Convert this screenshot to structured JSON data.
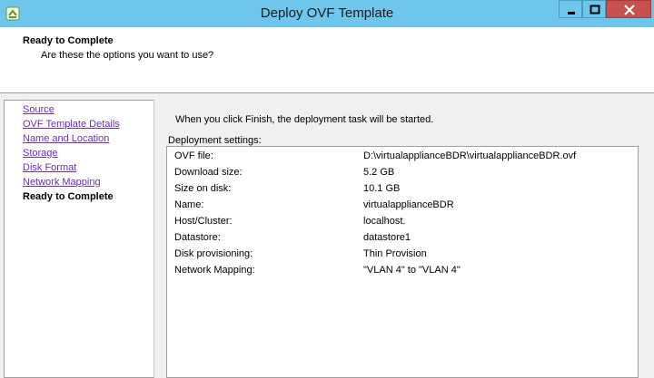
{
  "window": {
    "title": "Deploy OVF Template"
  },
  "header": {
    "title": "Ready to Complete",
    "subtitle": "Are these the options you want to use?"
  },
  "nav": {
    "items": [
      {
        "label": "Source",
        "current": false
      },
      {
        "label": "OVF Template Details",
        "current": false
      },
      {
        "label": "Name and Location",
        "current": false
      },
      {
        "label": "Storage",
        "current": false
      },
      {
        "label": "Disk Format",
        "current": false
      },
      {
        "label": "Network Mapping",
        "current": false
      },
      {
        "label": "Ready to Complete",
        "current": true
      }
    ]
  },
  "main": {
    "intro": "When you click Finish, the deployment task will be started.",
    "settings_label": "Deployment settings:",
    "settings": [
      {
        "name": "OVF file:",
        "value": "D:\\virtualapplianceBDR\\virtualapplianceBDR.ovf"
      },
      {
        "name": "Download size:",
        "value": "5.2 GB"
      },
      {
        "name": "Size on disk:",
        "value": "10.1 GB"
      },
      {
        "name": "Name:",
        "value": "virtualapplianceBDR"
      },
      {
        "name": "Host/Cluster:",
        "value": "localhost."
      },
      {
        "name": "Datastore:",
        "value": "datastore1"
      },
      {
        "name": "Disk provisioning:",
        "value": "Thin Provision"
      },
      {
        "name": "Network Mapping:",
        "value": "\"VLAN 4\" to \"VLAN 4\""
      }
    ]
  },
  "colors": {
    "titlebar": "#6dc6ec",
    "link": "#6b2fb0",
    "close_button": "#c75050"
  },
  "icons": {
    "app": "deploy-ovf-icon",
    "minimize": "minimize-icon",
    "maximize": "maximize-icon",
    "close": "close-icon"
  }
}
